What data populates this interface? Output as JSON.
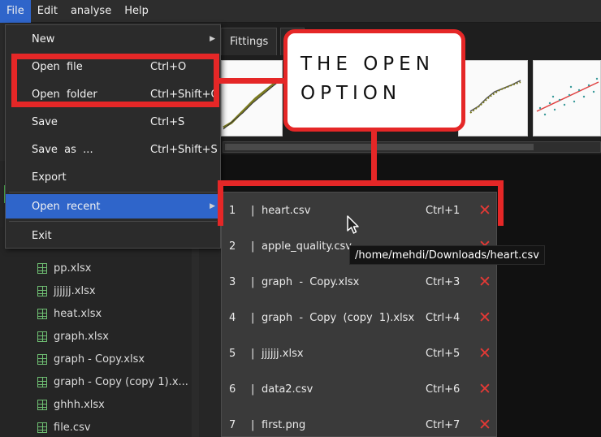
{
  "menubar": {
    "items": [
      "File",
      "Edit",
      "analyse",
      "Help"
    ]
  },
  "tabs": [
    "Fittings",
    "F"
  ],
  "file_menu": {
    "new": "New",
    "open_file": {
      "label": "Open  file",
      "shortcut": "Ctrl+O"
    },
    "open_folder": {
      "label": "Open  folder",
      "shortcut": "Ctrl+Shift+O"
    },
    "save": {
      "label": "Save",
      "shortcut": "Ctrl+S"
    },
    "save_as": {
      "label": "Save  as  ...",
      "shortcut": "Ctrl+Shift+S"
    },
    "export": "Export",
    "open_recent": "Open  recent",
    "exit": "Exit"
  },
  "recent_files": [
    {
      "num": "1",
      "name": "heart.csv",
      "shortcut": "Ctrl+1"
    },
    {
      "num": "2",
      "name": "apple_quality.csv",
      "shortcut": ""
    },
    {
      "num": "3",
      "name": "graph  -  Copy.xlsx",
      "shortcut": "Ctrl+3"
    },
    {
      "num": "4",
      "name": "graph  -  Copy  (copy  1).xlsx",
      "shortcut": "Ctrl+4"
    },
    {
      "num": "5",
      "name": "jjjjjj.xlsx",
      "shortcut": "Ctrl+5"
    },
    {
      "num": "6",
      "name": "data2.csv",
      "shortcut": "Ctrl+6"
    },
    {
      "num": "7",
      "name": "first.png",
      "shortcut": "Ctrl+7"
    }
  ],
  "recent_separator": "|",
  "tooltip": "/home/mehdi/Downloads/heart.csv",
  "file_tree": [
    {
      "name": "pp.xlsx",
      "icon": "spreadsheet-icon"
    },
    {
      "name": "jjjjjj.xlsx",
      "icon": "spreadsheet-icon"
    },
    {
      "name": "heat.xlsx",
      "icon": "spreadsheet-icon"
    },
    {
      "name": "graph.xlsx",
      "icon": "spreadsheet-icon"
    },
    {
      "name": "graph  -  Copy.xlsx",
      "icon": "spreadsheet-icon"
    },
    {
      "name": "graph  -  Copy  (copy  1).x...",
      "icon": "spreadsheet-icon"
    },
    {
      "name": "ghhh.xlsx",
      "icon": "spreadsheet-icon"
    },
    {
      "name": "file.csv",
      "icon": "spreadsheet-icon"
    }
  ],
  "callout": {
    "text": "THE OPEN\nOPTION"
  },
  "colors": {
    "accent": "#2f65ca",
    "annotation_red": "#e52727",
    "delete_red": "#e53935"
  }
}
